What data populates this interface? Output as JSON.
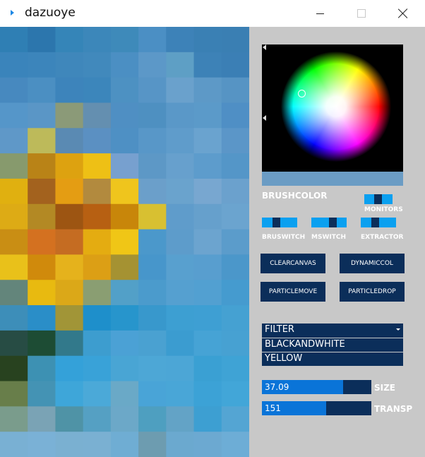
{
  "window": {
    "title": "dazuoye"
  },
  "canvas": {
    "rows": [
      [
        "#2f7fb4",
        "#2c76ad",
        "#3585b8",
        "#3c87ba",
        "#3e8aba",
        "#4b8fc4",
        "#3d82b8",
        "#3a80b4",
        "#3a7fb3"
      ],
      [
        "#3a84bb",
        "#3c85bb",
        "#3f87bb",
        "#4189bc",
        "#4b8fc3",
        "#5c98c8",
        "#5e9fc5",
        "#3d82b7",
        "#3b7fb5"
      ],
      [
        "#4789bf",
        "#4b8fc2",
        "#3d84bb",
        "#3c86bb",
        "#4d91c2",
        "#5795c6",
        "#6aa1cc",
        "#5d99c7",
        "#5694c4"
      ],
      [
        "#5596c9",
        "#5a96c6",
        "#8b9a78",
        "#648fb0",
        "#4f8fc3",
        "#4e90c1",
        "#5a98c8",
        "#5b9ac9",
        "#4f8fc5"
      ],
      [
        "#5f98c8",
        "#bdba5a",
        "#5a8ab3",
        "#5b90c2",
        "#4e90c4",
        "#5897c8",
        "#5f9ccb",
        "#6aa3cf",
        "#5b96c8"
      ],
      [
        "#879a6d",
        "#b98317",
        "#dda210",
        "#eec015",
        "#77a0cf",
        "#5d98c6",
        "#67a0cd",
        "#5d9ccc",
        "#5496c8"
      ],
      [
        "#e0b010",
        "#a3621e",
        "#e49d13",
        "#b28a3e",
        "#efc51d",
        "#6b9fca",
        "#6aa3cd",
        "#78a7d0",
        "#6ba1cd"
      ],
      [
        "#ddab15",
        "#b38924",
        "#9d5512",
        "#b76012",
        "#c8860a",
        "#d8c031",
        "#5f9ccb",
        "#66a0cc",
        "#6ba4cf"
      ],
      [
        "#c98e14",
        "#d47120",
        "#c56c22",
        "#e4ac11",
        "#f0c616",
        "#4b98cb",
        "#5d9ccb",
        "#6ca4cf",
        "#5b9ccb"
      ],
      [
        "#e9c11a",
        "#d08a0c",
        "#e5b21c",
        "#dc9f15",
        "#a59232",
        "#4796cb",
        "#58a0cf",
        "#589ecf",
        "#4b97ca"
      ],
      [
        "#63857b",
        "#e8ba10",
        "#dba818",
        "#8a9e72",
        "#52a0c8",
        "#4b9bcc",
        "#55a0d0",
        "#52a0d1",
        "#459bcf"
      ],
      [
        "#3d8eb9",
        "#2a8ec8",
        "#a19537",
        "#1e8fcb",
        "#2795cc",
        "#3898cc",
        "#3d9fd2",
        "#3e9fd3",
        "#45a1d2"
      ],
      [
        "#274c44",
        "#1d4c34",
        "#32798b",
        "#3d9dcf",
        "#4ba1d5",
        "#4aa1d1",
        "#3b9cd0",
        "#46a3d5",
        "#47a1d2"
      ],
      [
        "#28421f",
        "#3d91b3",
        "#34a1d9",
        "#39a2d8",
        "#49a5d4",
        "#4da7d6",
        "#4ca6d6",
        "#3aa0d3",
        "#3fa3d5"
      ],
      [
        "#687e4a",
        "#4493b4",
        "#3ea6d9",
        "#4ba9d8",
        "#6aa9c7",
        "#49a4d7",
        "#49a6d7",
        "#3ca2d6",
        "#42a6d8"
      ],
      [
        "#7a9c8c",
        "#7aa3b5",
        "#4f93a6",
        "#55a0c3",
        "#6ca8c8",
        "#4e9fc0",
        "#63a3c6",
        "#3d9fd2",
        "#54a5d3"
      ],
      [
        "#79b0d3",
        "#7ab1d6",
        "#7ab0d1",
        "#7ab0d2",
        "#6fadd3",
        "#6d9cb0",
        "#6ba9cf",
        "#6ca9d1",
        "#6dadd6"
      ]
    ]
  },
  "picker": {},
  "labels": {
    "brushcolor": "BRUSHCOLOR",
    "monitors": "MONITORS",
    "bruswitch": "BRUSWITCH",
    "mswitch": "MSWITCH",
    "extractor": "EXTRACTOR",
    "size": "SIZE",
    "transp": "TRANSP"
  },
  "buttons": {
    "clearcanvas": "CLEARCANVAS",
    "dynamiccol": "DYNAMICCOL",
    "particlemove": "PARTICLEMOVE",
    "particledrop": "PARTICLEDROP"
  },
  "filter": {
    "selected": "FILTER",
    "options": [
      "BLACKANDWHITE",
      "YELLOW"
    ]
  },
  "size": {
    "value": "37.09",
    "fill_fraction": 0.74
  },
  "transp": {
    "value": "151",
    "fill_fraction": 0.59
  },
  "colors": {
    "panel": "#c8c8c8",
    "dark": "#0b2e5a",
    "toggle": "#0aa0f0",
    "slider_fill": "#0a74d8"
  }
}
